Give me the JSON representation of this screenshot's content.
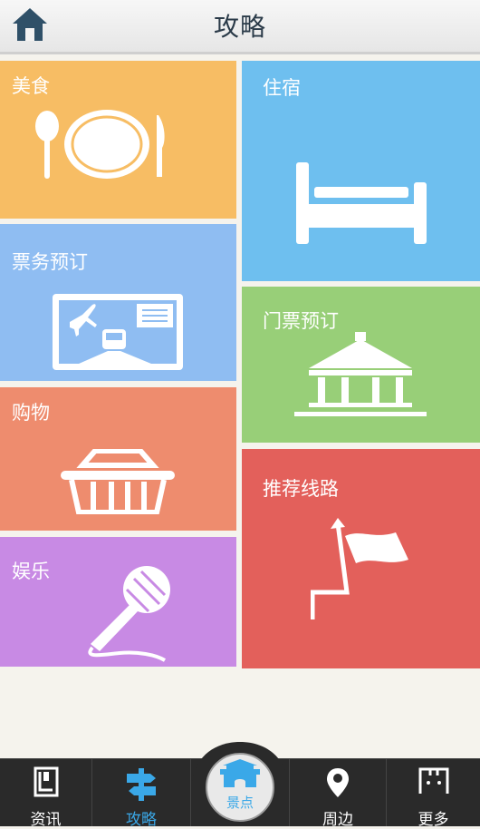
{
  "header": {
    "title": "攻略",
    "home_icon": "home-icon"
  },
  "tiles": {
    "food": {
      "label": "美食",
      "icon": "plate-cutlery-icon",
      "color": "#f7bd64"
    },
    "hotel": {
      "label": "住宿",
      "icon": "bed-icon",
      "color": "#6ebfef"
    },
    "ticket": {
      "label": "票务预订",
      "icon": "plane-train-ticket-icon",
      "color": "#8fbdf2"
    },
    "gate": {
      "label": "门票预订",
      "icon": "temple-icon",
      "color": "#98cf78"
    },
    "shopping": {
      "label": "购物",
      "icon": "basket-icon",
      "color": "#ee8c6e"
    },
    "route": {
      "label": "推荐线路",
      "icon": "flag-route-icon",
      "color": "#e3605b"
    },
    "ent": {
      "label": "娱乐",
      "icon": "microphone-icon",
      "color": "#c88ae4"
    }
  },
  "tabbar": {
    "items": [
      {
        "label": "资讯",
        "icon": "news-icon",
        "active": false
      },
      {
        "label": "攻略",
        "icon": "signpost-icon",
        "active": true
      },
      {
        "label": "景点",
        "icon": "gate-landmark-icon",
        "active": false
      },
      {
        "label": "周边",
        "icon": "location-pin-icon",
        "active": false
      },
      {
        "label": "更多",
        "icon": "more-icon",
        "active": false
      }
    ],
    "active_color": "#3aa8e8"
  }
}
